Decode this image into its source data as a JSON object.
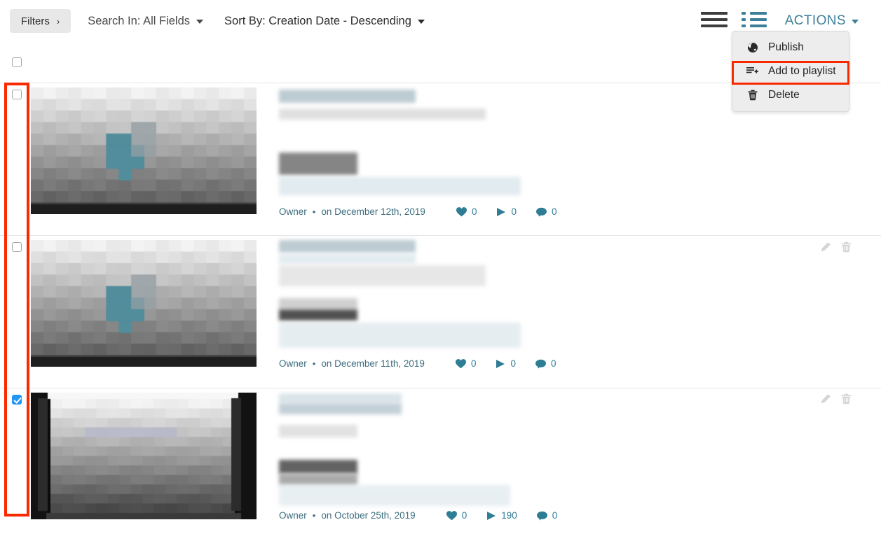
{
  "toolbar": {
    "filters_label": "Filters",
    "filters_chevron": "chevron-right-icon",
    "search_in_label": "Search In: All Fields",
    "sort_by_label": "Sort By: Creation Date - Descending",
    "actions_label": "ACTIONS",
    "grid_view_icon": "hamburger-view-icon",
    "list_view_icon": "list-view-icon",
    "accent_color": "#3d7f99",
    "active_view": "list"
  },
  "actions_menu": {
    "open": true,
    "highlighted_item": "Add to playlist",
    "highlight_color": "#fa2a00",
    "items": [
      {
        "label": "Publish",
        "icon": "globe-icon"
      },
      {
        "label": "Add to playlist",
        "icon": "add-to-playlist-icon"
      },
      {
        "label": "Delete",
        "icon": "trash-icon"
      }
    ]
  },
  "list": {
    "select_all_checked": false,
    "selection_highlight_color": "#fa2a00",
    "rows": [
      {
        "id": "row-1",
        "checked": false,
        "owner": "Owner",
        "separator": "•",
        "date": "on December 12th, 2019",
        "likes": "0",
        "plays": "0",
        "comments": "0",
        "show_row_actions": false,
        "thumbnail": "video-thumbnail-teal"
      },
      {
        "id": "row-2",
        "checked": false,
        "owner": "Owner",
        "separator": "•",
        "date": "on December 11th, 2019",
        "likes": "0",
        "plays": "0",
        "comments": "0",
        "show_row_actions": true,
        "thumbnail": "video-thumbnail-teal"
      },
      {
        "id": "row-3",
        "checked": true,
        "owner": "Owner",
        "separator": "•",
        "date": "on October 25th, 2019",
        "likes": "0",
        "plays": "190",
        "comments": "0",
        "show_row_actions": true,
        "thumbnail": "video-thumbnail-letterbox"
      }
    ],
    "row_action_icons": [
      {
        "name": "edit-icon"
      },
      {
        "name": "delete-icon"
      }
    ],
    "stat_icons": [
      {
        "name": "heart-icon"
      },
      {
        "name": "play-icon"
      },
      {
        "name": "comment-icon"
      }
    ]
  }
}
